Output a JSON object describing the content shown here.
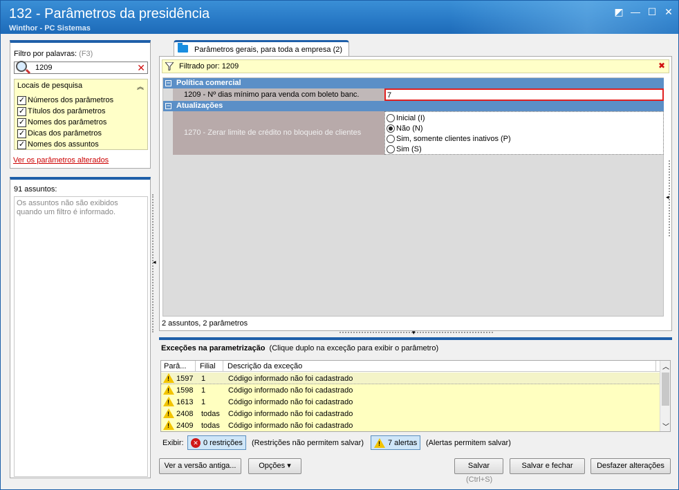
{
  "window": {
    "title": "132 - Parâmetros da presidência",
    "subtitle": "Winthor - PC Sistemas"
  },
  "left": {
    "filter_label": "Filtro por palavras:",
    "filter_hint": "(F3)",
    "search_value": "1209",
    "locais_title": "Locais de pesquisa",
    "locais": [
      {
        "label": "Números dos parâmetros",
        "checked": true
      },
      {
        "label": "Títulos dos parâmetros",
        "checked": true
      },
      {
        "label": "Nomes dos parâmetros",
        "checked": true
      },
      {
        "label": "Dicas dos parâmetros",
        "checked": true
      },
      {
        "label": "Nomes dos assuntos",
        "checked": true
      }
    ],
    "altered_link": "Ver os parâmetros alterados",
    "assuntos_count": "91 assuntos:",
    "assuntos_msg": "Os assuntos não são exibidos quando um filtro é informado."
  },
  "tab": {
    "label": "Parâmetros gerais, para toda a empresa",
    "count": "(2)"
  },
  "filterbar": {
    "text": "Filtrado por: 1209"
  },
  "groups": [
    {
      "title": "Política comercial",
      "param_label": "1209 - Nº dias mínimo para venda com boleto banc.",
      "param_value": "7"
    },
    {
      "title": "Atualizações",
      "param_label": "1270 - Zerar limite de crédito no bloqueio de clientes",
      "options": [
        {
          "label": "Inicial (I)",
          "selected": false
        },
        {
          "label": "Não (N)",
          "selected": true
        },
        {
          "label": "Sim, somente clientes inativos (P)",
          "selected": false
        },
        {
          "label": "Sim (S)",
          "selected": false
        }
      ]
    }
  ],
  "summary": "2 assuntos, 2 parâmetros",
  "exceptions": {
    "title": "Exceções na parametrização",
    "hint": "(Clique duplo na exceção para exibir o parâmetro)",
    "columns": [
      "Parâ...",
      "Filial",
      "Descrição da exceção"
    ],
    "rows": [
      {
        "param": "1597",
        "filial": "1",
        "desc": "Código informado não foi cadastrado"
      },
      {
        "param": "1598",
        "filial": "1",
        "desc": "Código informado não foi cadastrado"
      },
      {
        "param": "1613",
        "filial": "1",
        "desc": "Código informado não foi cadastrado"
      },
      {
        "param": "2408",
        "filial": "todas",
        "desc": "Código informado não foi cadastrado"
      },
      {
        "param": "2409",
        "filial": "todas",
        "desc": "Código informado não foi cadastrado"
      }
    ],
    "exibir_label": "Exibir:",
    "restricoes_btn": "0 restrições",
    "restricoes_note": "(Restrições não permitem salvar)",
    "alertas_btn": "7 alertas",
    "alertas_note": "(Alertas permitem salvar)"
  },
  "buttons": {
    "versao_antiga": "Ver a versão antiga...",
    "opcoes": "Opções ▾",
    "salvar": "Salvar",
    "salvar_shortcut": "(Ctrl+S)",
    "salvar_fechar": "Salvar e fechar",
    "desfazer": "Desfazer alterações"
  }
}
